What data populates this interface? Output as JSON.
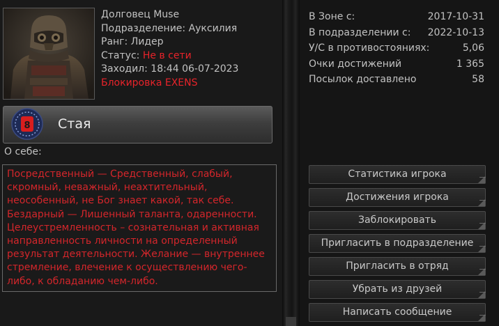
{
  "profile": {
    "name_line": "Долговец Muse",
    "division_line": "Подразделение: Ауксилия",
    "rank_line": "Ранг: Лидер",
    "status_label": "Статус:",
    "status_value": "Не в сети",
    "last_seen_line": "Заходил: 18:44 06-07-2023",
    "block_line": "Блокировка EXENS"
  },
  "squad": {
    "name": "Стая",
    "emblem_number": "8"
  },
  "about": {
    "label": "О себе:",
    "text": "Посредственный — Средственный, слабый, скромный, неважный, неахтительный, неособенный, не Бог знает какой, так себе. Бездарный — Лишенный таланта, одаренности. Целеустремленность – сознательная и активная направленность личности на определенный результат деятельности. Желание — внутреннее стремление, влечение к осуществлению чего-либо, к обладанию чем-либо."
  },
  "stats": [
    {
      "label": "В Зоне с:",
      "value": "2017-10-31"
    },
    {
      "label": "В подразделении с:",
      "value": "2022-10-13"
    },
    {
      "label": "У/С в противостояниях:",
      "value": "5,06"
    },
    {
      "label": "Очки достижений",
      "value": "1 365"
    },
    {
      "label": "Посылок доставлено",
      "value": "58"
    }
  ],
  "buttons": {
    "player_stats": "Статистика игрока",
    "player_achievements": "Достижения игрока",
    "block": "Заблокировать",
    "invite_division": "Пригласить в подразделение",
    "invite_squad": "Пригласить в отряд",
    "remove_friend": "Убрать из друзей",
    "send_message": "Написать сообщение"
  },
  "colors": {
    "status_offline": "#e8232a",
    "about_text": "#d4262b",
    "emblem_fill": "#d81e1e"
  }
}
